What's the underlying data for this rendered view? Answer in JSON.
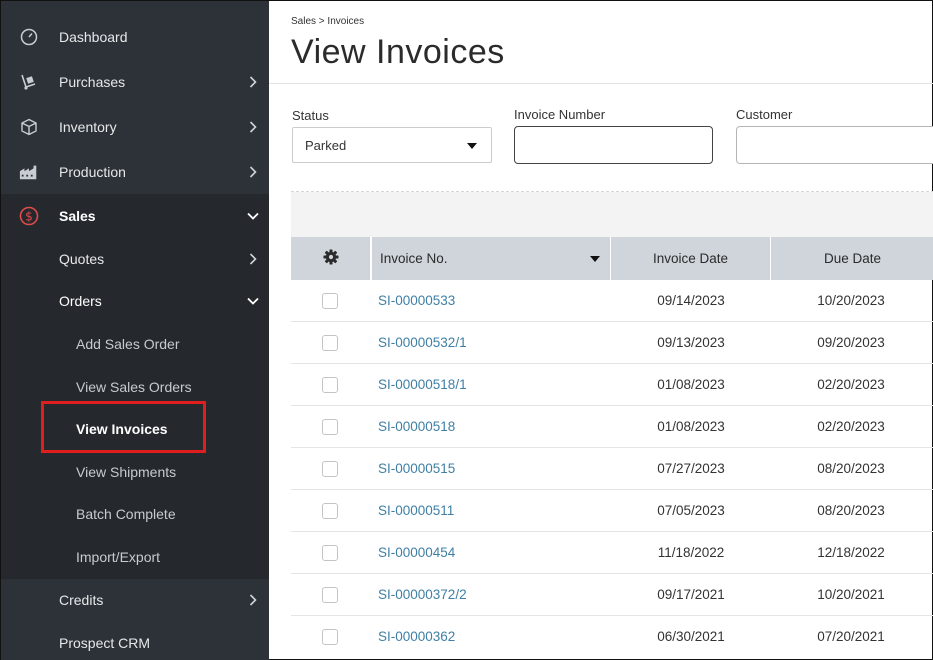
{
  "sidebar": {
    "items": [
      {
        "label": "Dashboard",
        "icon": "speedometer-icon"
      },
      {
        "label": "Purchases",
        "icon": "hand-truck-icon"
      },
      {
        "label": "Inventory",
        "icon": "box-icon"
      },
      {
        "label": "Production",
        "icon": "factory-icon"
      },
      {
        "label": "Sales",
        "icon": "dollar-circle-icon"
      }
    ],
    "sales_sub": [
      {
        "label": "Quotes"
      },
      {
        "label": "Orders"
      }
    ],
    "orders_sub": [
      {
        "label": "Add Sales Order"
      },
      {
        "label": "View Sales Orders"
      },
      {
        "label": "View Invoices"
      },
      {
        "label": "View Shipments"
      },
      {
        "label": "Batch Complete"
      },
      {
        "label": "Import/Export"
      }
    ],
    "bottom": [
      {
        "label": "Credits"
      },
      {
        "label": "Prospect CRM"
      }
    ],
    "accent_color": "#e04a4a"
  },
  "main": {
    "breadcrumb": "Sales > Invoices",
    "title": "View Invoices",
    "filters": {
      "status_label": "Status",
      "status_value": "Parked",
      "invoice_number_label": "Invoice Number",
      "invoice_number_value": "",
      "customer_label": "Customer",
      "customer_value": ""
    },
    "table": {
      "columns": [
        "Invoice No.",
        "Invoice Date",
        "Due Date"
      ],
      "rows": [
        {
          "invoice": "SI-00000533",
          "invoice_date": "09/14/2023",
          "due_date": "10/20/2023"
        },
        {
          "invoice": "SI-00000532/1",
          "invoice_date": "09/13/2023",
          "due_date": "09/20/2023"
        },
        {
          "invoice": "SI-00000518/1",
          "invoice_date": "01/08/2023",
          "due_date": "02/20/2023"
        },
        {
          "invoice": "SI-00000518",
          "invoice_date": "01/08/2023",
          "due_date": "02/20/2023"
        },
        {
          "invoice": "SI-00000515",
          "invoice_date": "07/27/2023",
          "due_date": "08/20/2023"
        },
        {
          "invoice": "SI-00000511",
          "invoice_date": "07/05/2023",
          "due_date": "08/20/2023"
        },
        {
          "invoice": "SI-00000454",
          "invoice_date": "11/18/2022",
          "due_date": "12/18/2022"
        },
        {
          "invoice": "SI-00000372/2",
          "invoice_date": "09/17/2021",
          "due_date": "10/20/2021"
        },
        {
          "invoice": "SI-00000362",
          "invoice_date": "06/30/2021",
          "due_date": "07/20/2021"
        }
      ]
    },
    "link_color": "#3f7fa5"
  }
}
